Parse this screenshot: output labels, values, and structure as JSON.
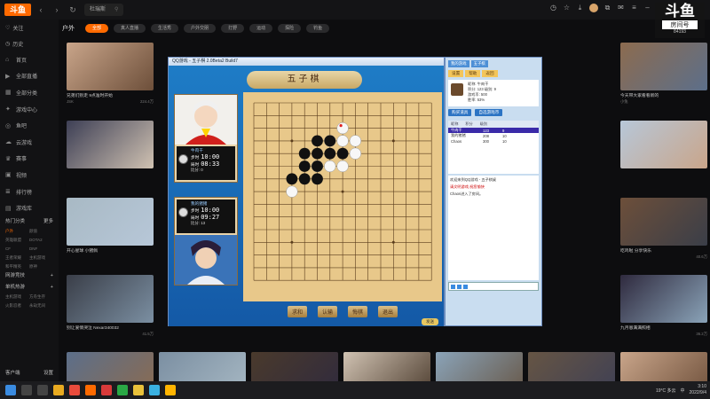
{
  "header": {
    "logo": "斗鱼",
    "tab_label": "杜瑞斯",
    "brand": {
      "main": "斗鱼",
      "sub": "房间号",
      "room": "84193"
    }
  },
  "sidebar": {
    "follow_label": "关注",
    "history_label": "历史",
    "items": [
      {
        "label": "首页",
        "icon": "home-icon"
      },
      {
        "label": "全部直播",
        "icon": "live-icon"
      },
      {
        "label": "全部分类",
        "icon": "category-icon"
      },
      {
        "label": "游戏中心",
        "icon": "gamepad-icon"
      },
      {
        "label": "鱼吧",
        "icon": "fish-icon"
      },
      {
        "label": "云游戏",
        "icon": "cloud-icon"
      },
      {
        "label": "赛事",
        "icon": "trophy-icon"
      },
      {
        "label": "视频",
        "icon": "video-icon"
      },
      {
        "label": "排行榜",
        "icon": "rank-icon"
      },
      {
        "label": "游戏库",
        "icon": "library-icon"
      }
    ],
    "section1": {
      "title": "热门分类",
      "more": "更多"
    },
    "section1_items": [
      "户外",
      "颜值",
      "英雄联盟",
      "DOTA2",
      "CF",
      "DNF",
      "王者荣耀",
      "主机游戏",
      "和平精英",
      "原神"
    ],
    "section2": {
      "title": "网游竞技",
      "more": "+"
    },
    "section3": {
      "title": "单机热游",
      "more": "+"
    },
    "section3_items": [
      "主机游戏",
      "方舟生存",
      "火影忍者",
      "永劫无间"
    ],
    "footer": {
      "download": "客户端",
      "settings": "设置"
    }
  },
  "category": {
    "title": "户外",
    "chips": [
      "全部",
      "真人直播",
      "生活秀",
      "户外交朋",
      "打野",
      "运动",
      "探险",
      "钓鱼"
    ]
  },
  "tiles": [
    {
      "title": "兄弟们别走 9点准时开始",
      "anchor": "JSK",
      "views": "224.4万"
    },
    {
      "title": "今天带大家看看新的",
      "anchor": "小兔",
      "views": ""
    },
    {
      "title": "",
      "anchor": "",
      "views": ""
    },
    {
      "title": "",
      "anchor": "",
      "views": ""
    },
    {
      "title": "开心星球 小猪佩",
      "anchor": "",
      "views": ""
    },
    {
      "title": "吃鸡啦 分享快乐",
      "anchor": "",
      "views": "40.6万"
    },
    {
      "title": "别让爱情哭泣 Nexar340032",
      "anchor": "",
      "views": "41.5万"
    },
    {
      "title": "九月恩满满照相",
      "anchor": "",
      "views": "36.2万"
    },
    {
      "title": "",
      "anchor": "",
      "views": ""
    },
    {
      "title": "",
      "anchor": "",
      "views": ""
    },
    {
      "title": "",
      "anchor": "",
      "views": ""
    },
    {
      "title": "",
      "anchor": "",
      "views": ""
    },
    {
      "title": "中原福利 看看",
      "anchor": "",
      "views": ""
    },
    {
      "title": "我是大主播",
      "anchor": "",
      "views": ""
    },
    {
      "title": "叫我杰哥 勇往直前",
      "anchor": "",
      "views": ""
    },
    {
      "title": "",
      "anchor": "",
      "views": ""
    },
    {
      "title": "",
      "anchor": "",
      "views": ""
    },
    {
      "title": "",
      "anchor": "",
      "views": ""
    },
    {
      "title": "❤️你吗❤️深层给人小可爱",
      "anchor": "",
      "views": "4.6万"
    },
    {
      "title": "野性新消息628705",
      "anchor": "中央户外视频",
      "views": "5.4万"
    },
    {
      "title": "四级专家第一视频第1",
      "anchor": "",
      "views": ""
    },
    {
      "title": "第三人我游戏第 大赛",
      "anchor": "",
      "views": "2.8万"
    },
    {
      "title": "上学新闻事 902.929",
      "anchor": "",
      "views": "2.5万"
    },
    {
      "title": "人生长梦 版版秘法8041",
      "anchor": "中央游戏",
      "views": ""
    },
    {
      "title": "",
      "anchor": "",
      "views": "2.5万"
    }
  ],
  "game": {
    "window_title": "QQ游戏 - 五子棋 2.0Beta2 Build7",
    "title": "五子棋",
    "player1": {
      "name": "牛肉干",
      "step_label": "步时",
      "step_time": "10:00",
      "total_label": "局时",
      "total_time": "08:33",
      "score": "比分: 0"
    },
    "player2": {
      "name": "我的猪猪",
      "step_label": "步时",
      "step_time": "10:00",
      "total_label": "局时",
      "total_time": "09:27",
      "score": "比分: 13"
    },
    "buttons": [
      "求和",
      "认输",
      "悔棋",
      "退出"
    ],
    "send_label": "发送",
    "board": {
      "size": 15,
      "black": [
        [
          5,
          3
        ],
        [
          6,
          3
        ],
        [
          4,
          4
        ],
        [
          5,
          4
        ],
        [
          6,
          4
        ],
        [
          7,
          4
        ],
        [
          4,
          5
        ],
        [
          5,
          5
        ],
        [
          3,
          6
        ],
        [
          4,
          6
        ],
        [
          5,
          6
        ]
      ],
      "white": [
        [
          7,
          2
        ],
        [
          6,
          3
        ],
        [
          7,
          3
        ],
        [
          8,
          3
        ],
        [
          8,
          4
        ],
        [
          5,
          5
        ],
        [
          6,
          5
        ],
        [
          7,
          5
        ],
        [
          3,
          7
        ]
      ],
      "marker": [
        [
          7,
          2
        ]
      ]
    }
  },
  "panel": {
    "top_tabs": [
      "我的游戏",
      "五子棋"
    ],
    "menu": [
      "设置",
      "帮助",
      "返回"
    ],
    "user": {
      "nick_label": "昵称:",
      "nick": "牛肉干",
      "level_label": "级别:",
      "level": "9",
      "score_label": "积分:",
      "score": "123",
      "coin_label": "游戏币:",
      "coin": "500",
      "win_label": "胜率:",
      "win": "53%"
    },
    "actions": [
      "购买道具",
      "自选游戏币"
    ],
    "list_header": [
      "昵称",
      "积分",
      "级别"
    ],
    "list_rows": [
      {
        "name": "牛肉干",
        "score": "123",
        "level": "9",
        "selected": true
      },
      {
        "name": "我的猪猪",
        "score": "208",
        "level": "10",
        "selected": false
      },
      {
        "name": "Chaos",
        "score": "300",
        "level": "10",
        "selected": false
      }
    ],
    "chat": [
      {
        "text": "欢迎来到QQ游戏 - 五子棋桌",
        "red": false
      },
      {
        "text": "请文明游戏,祝您愉快",
        "red": true
      },
      {
        "text": "Chaos进入了房间。",
        "red": false
      }
    ]
  },
  "taskbar": {
    "weather": "19°C 多云",
    "lang": "中",
    "time": "3:10",
    "date": "2022/9/4"
  }
}
